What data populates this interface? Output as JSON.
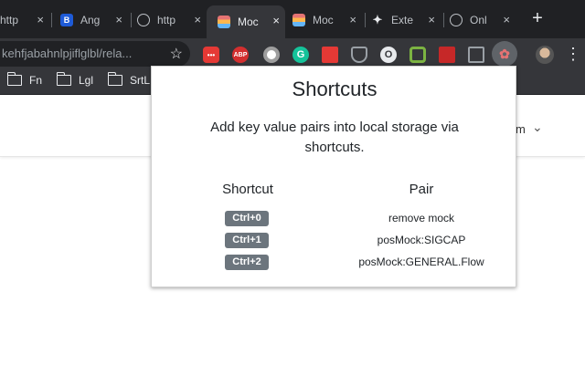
{
  "browser": {
    "tabs": [
      {
        "label": "http",
        "favicon": "globe-icon",
        "active": false
      },
      {
        "label": "Ang",
        "favicon": "bootstrap-icon",
        "active": false
      },
      {
        "label": "http",
        "favicon": "globe-icon",
        "active": false
      },
      {
        "label": "Moc",
        "favicon": "mock-extension-icon",
        "active": true
      },
      {
        "label": "Moc",
        "favicon": "mock-extension-icon",
        "active": false
      },
      {
        "label": "Exte",
        "favicon": "puzzle-icon",
        "active": false
      },
      {
        "label": "Onl",
        "favicon": "globe-icon",
        "active": false
      }
    ],
    "close_glyph": "×",
    "new_tab_glyph": "+",
    "url": "kehfjabahnlpjiflglbl/rela...",
    "star_glyph": "☆",
    "extensions": [
      {
        "name": "dots-extension-icon",
        "text": "•••",
        "color": "#e53935"
      },
      {
        "name": "adblock-plus-icon",
        "text": "ABP",
        "color": "#d32f2f"
      },
      {
        "name": "circle-extension-icon",
        "text": "",
        "color": "#9e9e9e"
      },
      {
        "name": "grammarly-icon",
        "text": "G",
        "color": "#15c39a"
      },
      {
        "name": "stack-extension-icon",
        "text": "",
        "color": "#e53935"
      },
      {
        "name": "pocket-icon",
        "text": "",
        "color": "#5f6368"
      },
      {
        "name": "o-extension-icon",
        "text": "O",
        "color": "#9aa0a6"
      },
      {
        "name": "green-extension-icon",
        "text": "",
        "color": "#7cb342"
      },
      {
        "name": "book-extension-icon",
        "text": "",
        "color": "#c62828"
      },
      {
        "name": "square-extension-icon",
        "text": "",
        "color": "#9aa0a6"
      }
    ],
    "bookmarks": [
      {
        "label": "Fn"
      },
      {
        "label": "Lgl"
      },
      {
        "label": "SrtL"
      }
    ],
    "menu_glyph": "⋮"
  },
  "page": {
    "header_trail": "m",
    "chevron_glyph": "⌄"
  },
  "popup": {
    "title": "Shortcuts",
    "description": "Add key value pairs into local storage via shortcuts.",
    "columns": {
      "shortcut": "Shortcut",
      "pair": "Pair"
    },
    "rows": [
      {
        "key": "Ctrl+0",
        "pair": "remove mock"
      },
      {
        "key": "Ctrl+1",
        "pair": "posMock:SIGCAP"
      },
      {
        "key": "Ctrl+2",
        "pair": "posMock:GENERAL.Flow"
      }
    ]
  },
  "colors": {
    "tabstrip": "#202124",
    "toolbar": "#35363a",
    "badge": "#6c757d"
  }
}
